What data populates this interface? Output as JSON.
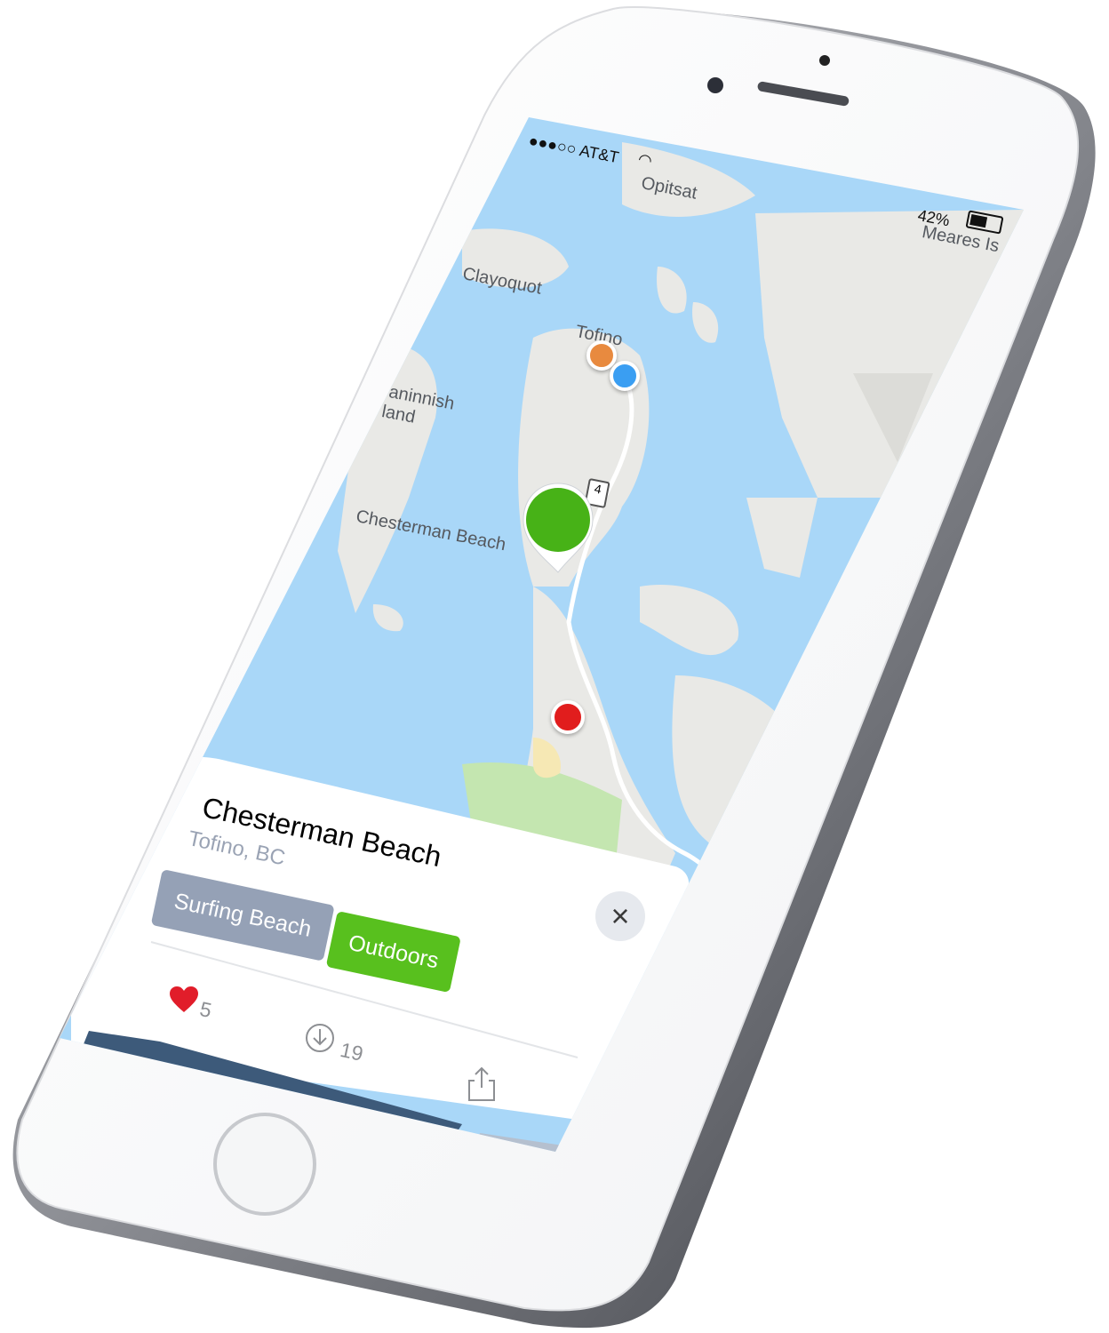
{
  "status_bar": {
    "signal": "●●●○○ AT&T",
    "battery": "42%"
  },
  "map": {
    "place_labels": {
      "opitsat": "Opitsat",
      "meares": "Meares Is",
      "clayoquot": "Clayoquot",
      "tofino": "Tofino",
      "wickaninnish": "aninnish",
      "island": "land",
      "chesterman": "Chesterman Beach",
      "route": "4"
    },
    "pin_colors": {
      "orange": "#e88a3f",
      "blue": "#3a9ef2",
      "green": "#47b217",
      "red": "#e11d1d"
    }
  },
  "card": {
    "title": "Chesterman Beach",
    "subtitle": "Tofino, BC",
    "tags": [
      "Surfing Beach",
      "Outdoors"
    ],
    "close_icon": "×",
    "likes": "5",
    "downloads": "19"
  },
  "colors": {
    "water": "#a9d7f8",
    "land": "#e9e9e6",
    "park": "#c4e6b0",
    "accent_green": "#58c01e",
    "tag_gray": "#95a1b6"
  }
}
